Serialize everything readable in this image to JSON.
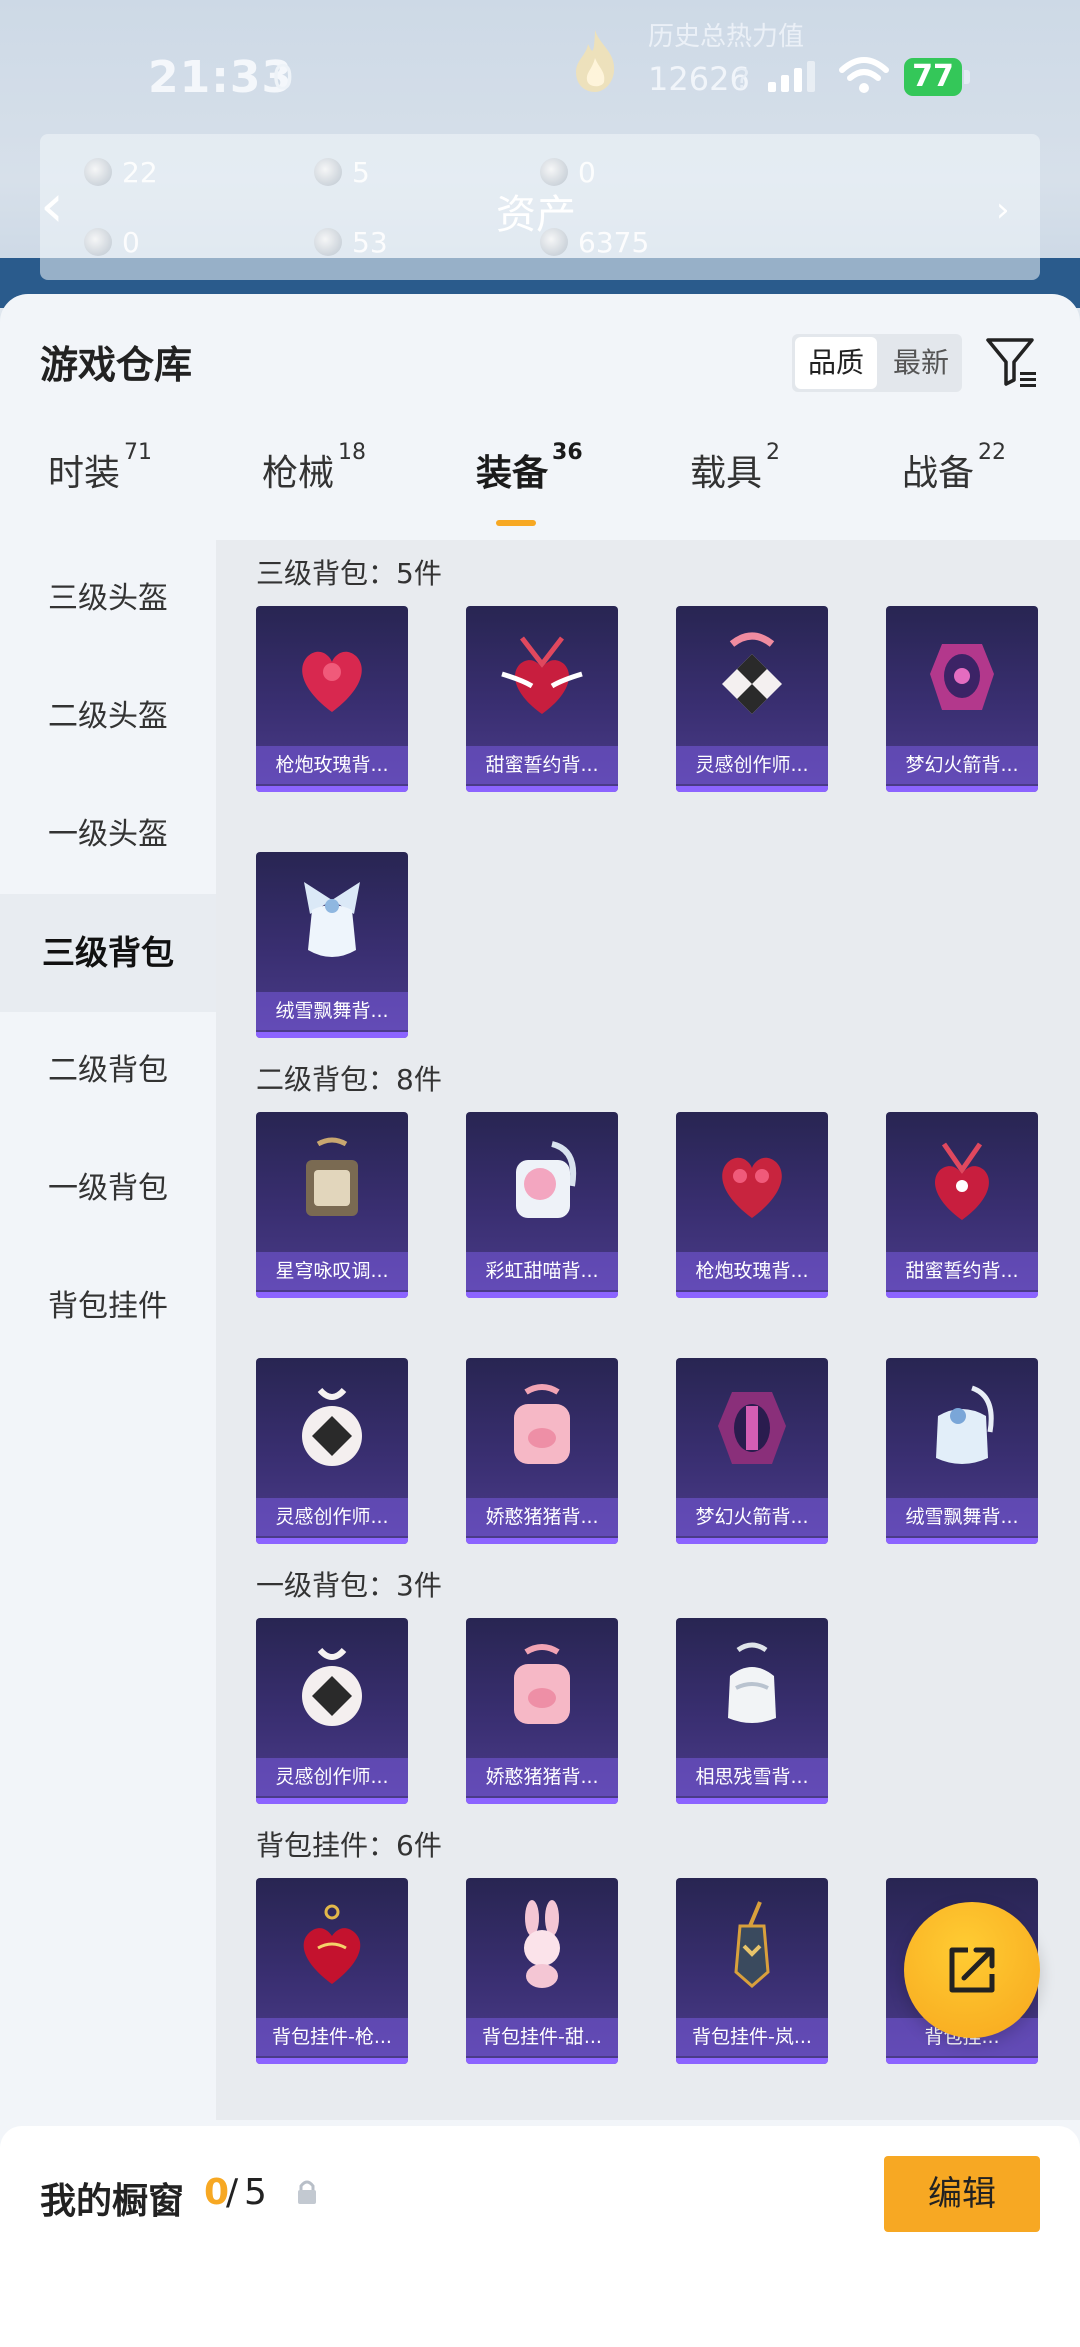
{
  "status_bar": {
    "time": "21:33",
    "extra": "0",
    "history_label": "历史总热力值",
    "history_value": "12626",
    "q_mark": "?",
    "battery": "77"
  },
  "asset_header": {
    "title": "资产",
    "values": [
      "22",
      "5",
      "0",
      "0",
      "53",
      "6375"
    ]
  },
  "warehouse": {
    "title": "游戏仓库",
    "sort_quality": "品质",
    "sort_newest": "最新"
  },
  "tabs": [
    {
      "label": "时装",
      "count": "71"
    },
    {
      "label": "枪械",
      "count": "18"
    },
    {
      "label": "装备",
      "count": "36"
    },
    {
      "label": "载具",
      "count": "2"
    },
    {
      "label": "战备",
      "count": "22"
    }
  ],
  "sidebar": [
    "三级头盔",
    "二级头盔",
    "一级头盔",
    "三级背包",
    "二级背包",
    "一级背包",
    "背包挂件"
  ],
  "sections": [
    {
      "title": "三级背包：5件",
      "items": [
        "枪炮玫瑰背...",
        "甜蜜誓约背...",
        "灵感创作师...",
        "梦幻火箭背...",
        "绒雪飘舞背..."
      ]
    },
    {
      "title": "二级背包：8件",
      "items": [
        "星穹咏叹调...",
        "彩虹甜喵背...",
        "枪炮玫瑰背...",
        "甜蜜誓约背...",
        "灵感创作师...",
        "娇憨猪猪背...",
        "梦幻火箭背...",
        "绒雪飘舞背..."
      ]
    },
    {
      "title": "一级背包：3件",
      "items": [
        "灵感创作师...",
        "娇憨猪猪背...",
        "相思残雪背..."
      ]
    },
    {
      "title": "背包挂件：6件",
      "items": [
        "背包挂件-枪...",
        "背包挂件-甜...",
        "背包挂件-岚...",
        "背包挂..."
      ]
    }
  ],
  "showcase": {
    "label": "我的橱窗",
    "count": "0",
    "sep": "/",
    "total": "5",
    "edit": "编辑"
  },
  "colors": {
    "accent": "#f7a823",
    "card_bg": "#2f2b63",
    "card_strip": "#8c64ff"
  }
}
